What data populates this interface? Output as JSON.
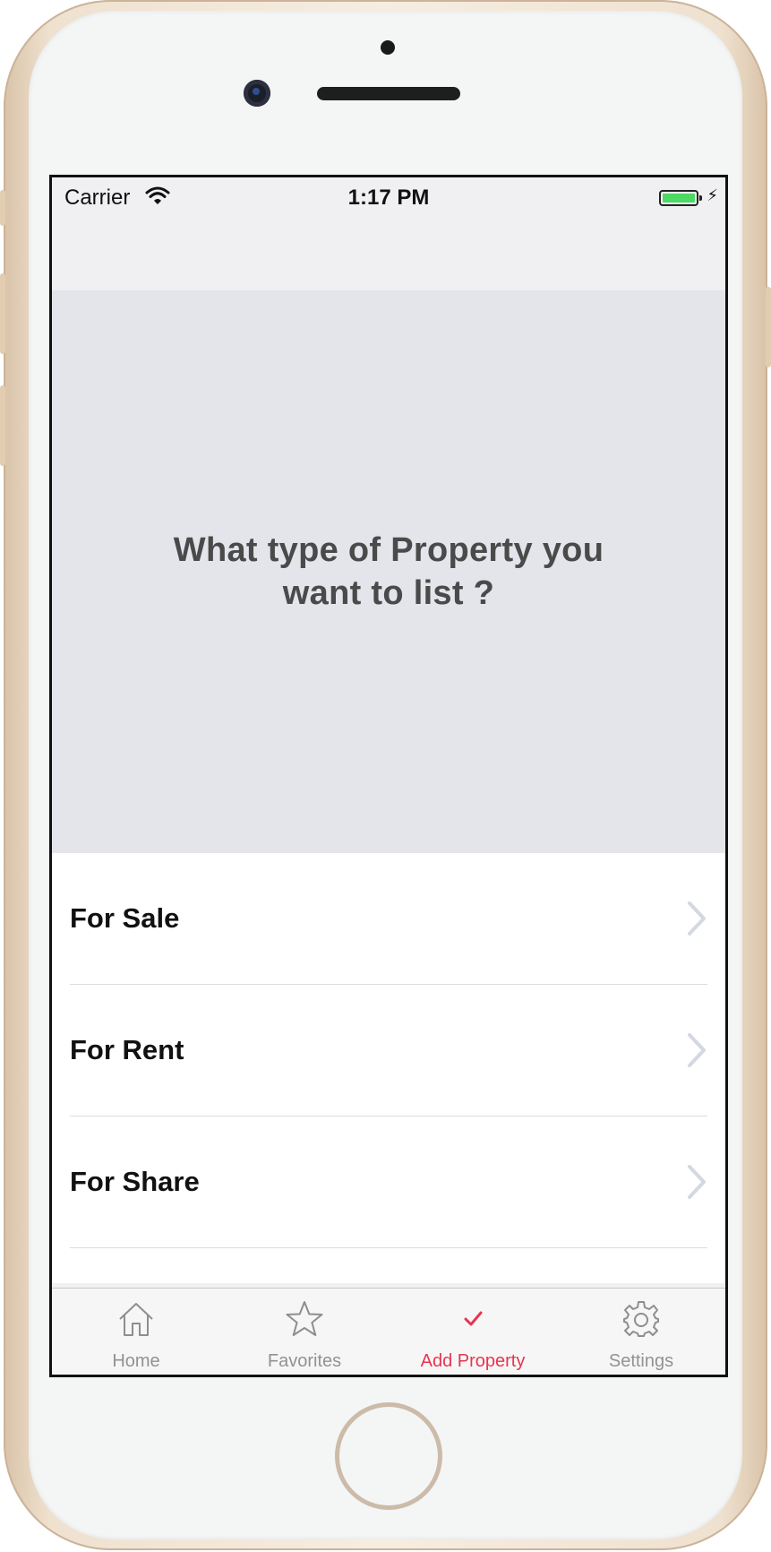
{
  "status_bar": {
    "carrier": "Carrier",
    "time": "1:17 PM",
    "battery_level": 1.0,
    "charging": true,
    "battery_color": "#4cd964"
  },
  "hero": {
    "title": "What type of Property you want to list ?",
    "background_color": "#e3e5eb"
  },
  "listing_types": [
    {
      "label": "For Sale",
      "icon": "chevron-right-icon"
    },
    {
      "label": "For Rent",
      "icon": "chevron-right-icon"
    },
    {
      "label": "For Share",
      "icon": "chevron-right-icon"
    }
  ],
  "tab_bar": {
    "active_color": "#e8354f",
    "tabs": [
      {
        "label": "Home",
        "icon": "home-icon",
        "active": false
      },
      {
        "label": "Favorites",
        "icon": "star-icon",
        "active": false
      },
      {
        "label": "Add Property",
        "icon": "checkmark-icon",
        "active": true
      },
      {
        "label": "Settings",
        "icon": "gear-icon",
        "active": false
      }
    ]
  }
}
